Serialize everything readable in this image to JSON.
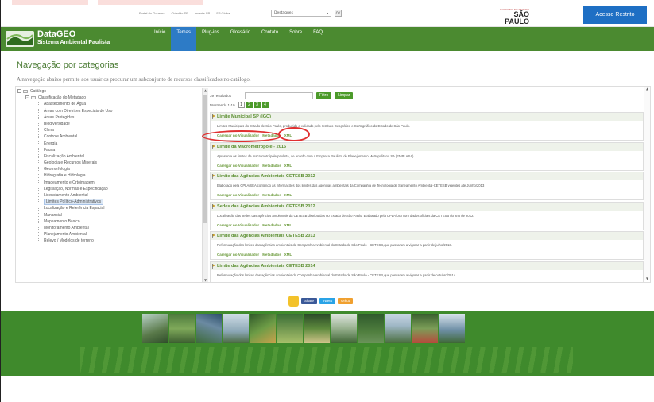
{
  "topbar": {
    "links": [
      "Portal do Governo",
      "Cidadão SP",
      "Investe SP",
      "SP Global"
    ],
    "select_value": "Destaques",
    "select_caret": "▾",
    "go_label": "OK",
    "gov_logo": {
      "small": "GOVERNO DO ESTADO",
      "big": "SÃO PAULO"
    },
    "acesso_label": "Acesso Restrito"
  },
  "header": {
    "brand_title": "DataGEO",
    "brand_subtitle": "Sistema Ambiental Paulista",
    "nav": [
      "Início",
      "Temas",
      "Plug-ins",
      "Glossário",
      "Contato",
      "Sobre",
      "FAQ"
    ],
    "active_nav": "Temas",
    "colors": {
      "green": "#4b8a30",
      "active_tab": "#2d7bc6"
    }
  },
  "main": {
    "title": "Navegação por categorias",
    "subtitle": "A navegação abaixo permite aos usuários procurar um subconjunto de recursos classificados no catálogo."
  },
  "tree": {
    "root": "Catálogo",
    "group": "Classificação do Metadado",
    "expand_symbol": "−",
    "items": [
      "Abastecimento de Água",
      "Áreas com Diretrizes Especiais de Uso",
      "Áreas Protegidas",
      "Biodiversidade",
      "Clima",
      "Controle Ambiental",
      "Energia",
      "Fauna",
      "Fiscalização Ambiental",
      "Geologia e Recursos Minerais",
      "Geomorfologia",
      "Hidrografia e Hidrologia",
      "Imageamento e Ortoimagem",
      "Legislação, Normas e Especificação",
      "Licenciamento Ambiental",
      "Limites Político-Administrativos",
      "Localização e Referência Espacial",
      "Manancial",
      "Mapeamento Básico",
      "Monitoramento Ambiental",
      "Planejamento Ambiental",
      "Relevo / Modelos de terreno"
    ],
    "selected": "Limites Político-Administrativos"
  },
  "results": {
    "count_text": "39 resultados",
    "filter_label": "Filtro",
    "clear_label": "Limpar",
    "showing_text": "Mostrando 1-10",
    "pages": [
      "1",
      "2",
      "3",
      "4"
    ],
    "current_page": "1",
    "link_labels": {
      "load": "Carregar no Visualizador",
      "meta": "Metadados",
      "xml": "XML"
    },
    "items": [
      {
        "title": "Limite Municipal SP (IGC)",
        "desc": "Limites Municipais do Estado de São Paulo, produzido e validado pelo Instituto Geográfico e Cartográfico do Estado de São Paulo."
      },
      {
        "title": "Limite da Macrometrópole - 2015",
        "desc": "Apresenta os limites da macrometrópole paulista, de acordo com a Empresa Paulista de Planejamento Metropolitano SA (EMPLASA)."
      },
      {
        "title": "Limite das Agências Ambientais CETESB 2012",
        "desc": "Elaborado pela CPLA/SEA contendo as informações dos limites das agências ambientais da Companhia de Tecnologia de Saneamento Ambiental-CETESB vigentes até Junho/2013"
      },
      {
        "title": "Sedes das Agências Ambientais CETESB 2012",
        "desc": "Localização das sedes das agências ambientais da CETESB distribuídas no Estado de São Paulo. Elaborado pela CPLA/DIA com dados oficiais da CETESB do ano de 2012."
      },
      {
        "title": "Limite das Agências Ambientais CETESB 2013",
        "desc": "Reformulação dos limites das agências ambientais da Companhia Ambiental do Estado de São Paulo - CETESB,que passaram a vigorar a partir de julho/2013."
      },
      {
        "title": "Limite das Agências Ambientais CETESB 2014",
        "desc": "Reformulação dos limites das agências ambientais da Companhia Ambiental do Estado de São Paulo - CETESB,que passaram a vigorar a partir de outubro/2014."
      }
    ]
  },
  "social": {
    "share": "Share",
    "tweet": "Tweet",
    "extra": "Orkut"
  },
  "scroll": {
    "up": "▲",
    "down": "▼"
  }
}
